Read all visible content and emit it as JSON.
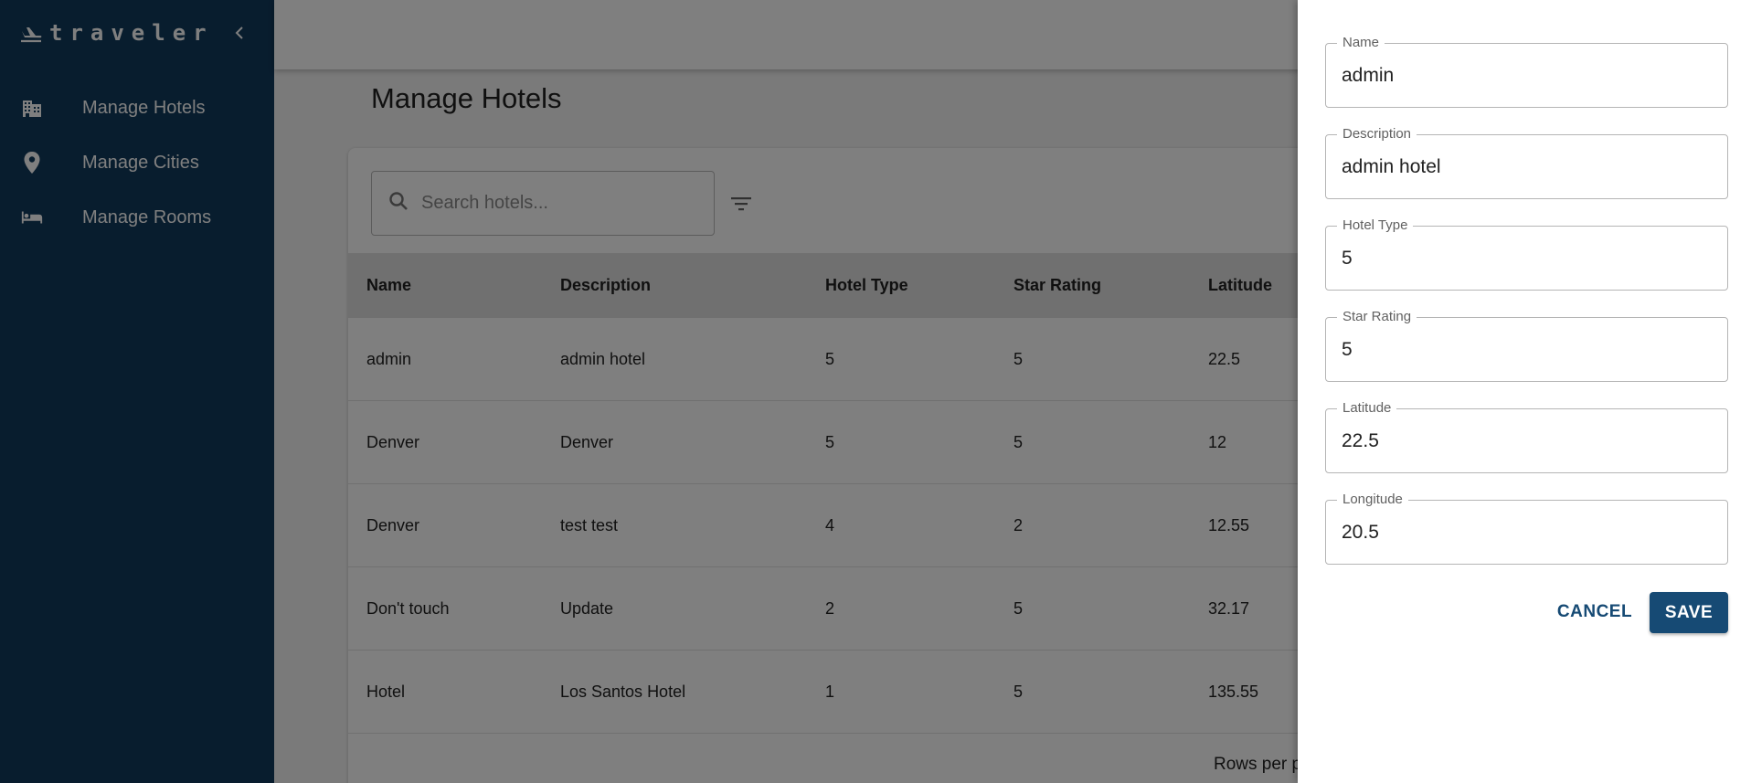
{
  "brand": {
    "name": "traveler",
    "icon": "airplane-takeoff-icon",
    "collapse_icon": "chevron-left-icon"
  },
  "sidebar": {
    "items": [
      {
        "label": "Manage Hotels",
        "icon": "hotel-building-icon"
      },
      {
        "label": "Manage Cities",
        "icon": "map-pin-icon"
      },
      {
        "label": "Manage Rooms",
        "icon": "bed-icon"
      }
    ]
  },
  "main": {
    "title": "Manage Hotels",
    "search": {
      "placeholder": "Search hotels..."
    },
    "table": {
      "columns": [
        "Name",
        "Description",
        "Hotel Type",
        "Star Rating",
        "Latitude"
      ],
      "rows": [
        [
          "admin",
          "admin hotel",
          "5",
          "5",
          "22.5"
        ],
        [
          "Denver",
          "Denver",
          "5",
          "5",
          "12"
        ],
        [
          "Denver",
          "test test",
          "4",
          "2",
          "12.55"
        ],
        [
          "Don't touch",
          "Update",
          "2",
          "5",
          "32.17"
        ],
        [
          "Hotel",
          "Los Santos Hotel",
          "1",
          "5",
          "135.55"
        ]
      ]
    },
    "footer": {
      "rows_per_page": "Rows per pa"
    }
  },
  "drawer": {
    "fields": [
      {
        "label": "Name",
        "value": "admin"
      },
      {
        "label": "Description",
        "value": "admin hotel"
      },
      {
        "label": "Hotel Type",
        "value": "5"
      },
      {
        "label": "Star Rating",
        "value": "5"
      },
      {
        "label": "Latitude",
        "value": "22.5"
      },
      {
        "label": "Longitude",
        "value": "20.5"
      }
    ],
    "cancel_label": "CANCEL",
    "save_label": "SAVE"
  },
  "colors": {
    "sidebar": "#113a5c",
    "primary": "#164a74",
    "header_row": "#e0e0e0"
  }
}
